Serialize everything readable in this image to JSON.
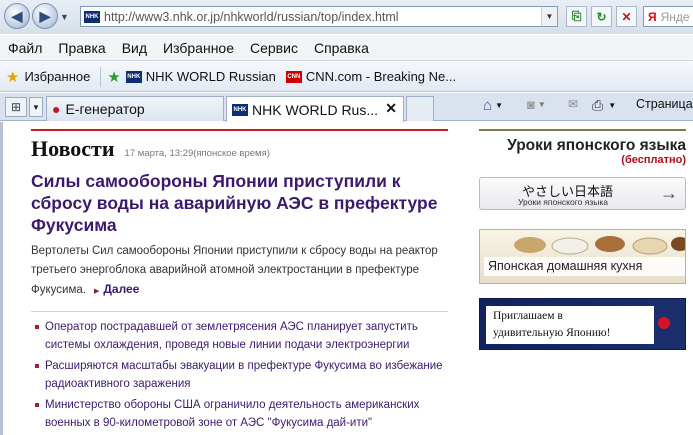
{
  "browser": {
    "url": "http://www3.nhk.or.jp/nhkworld/russian/top/index.html",
    "search_placeholder": "Янде",
    "menu": [
      "Файл",
      "Правка",
      "Вид",
      "Избранное",
      "Сервис",
      "Справка"
    ],
    "favorites_label": "Избранное",
    "favorites": [
      "NHK WORLD Russian",
      "CNN.com - Breaking Ne..."
    ],
    "tabs": [
      {
        "label": "Е-генератор",
        "active": false
      },
      {
        "label": "NHK WORLD Rus...",
        "active": true
      }
    ],
    "page_menu_label": "Страница"
  },
  "news": {
    "section_title": "Новости",
    "timestamp": "17 марта, 13:29(японское время)",
    "headline": "Силы самообороны Японии приступили к сбросу воды на аварийную АЭС в префектуре Фукусима",
    "lead": "Вертолеты Сил самообороны Японии приступили к сбросу воды на реактор третьего энергоблока аварийной атомной электростанции в префектуре Фукусима.",
    "more_label": "Далее",
    "items": [
      "Оператор пострадавшей от землетрясения АЭС планирует запустить системы охлаждения, проведя новые линии подачи электроэнергии",
      "Расширяются масштабы эвакуации в префектуре Фукусима во избежание радиоактивного заражения",
      "Министерство обороны США ограничило деятельность американских военных в 90-километровой зоне от АЭС \"Фукусима дай-ити\""
    ]
  },
  "sidebar": {
    "lessons_title": "Уроки японского языка",
    "lessons_free": "(бесплатно)",
    "lesson_button_jp": "やさしい日本語",
    "lesson_button_ru": "Уроки японского языка",
    "kitchen_banner": "Японская домашняя кухня",
    "japan_banner_line1": "Приглашаем в",
    "japan_banner_line2": "удивительную Японию!"
  },
  "colors": {
    "headline": "#3b1a6e",
    "news_rule": "#cc1a1a",
    "sidebar_rule": "#807a45",
    "free_label": "#b10c1c"
  }
}
